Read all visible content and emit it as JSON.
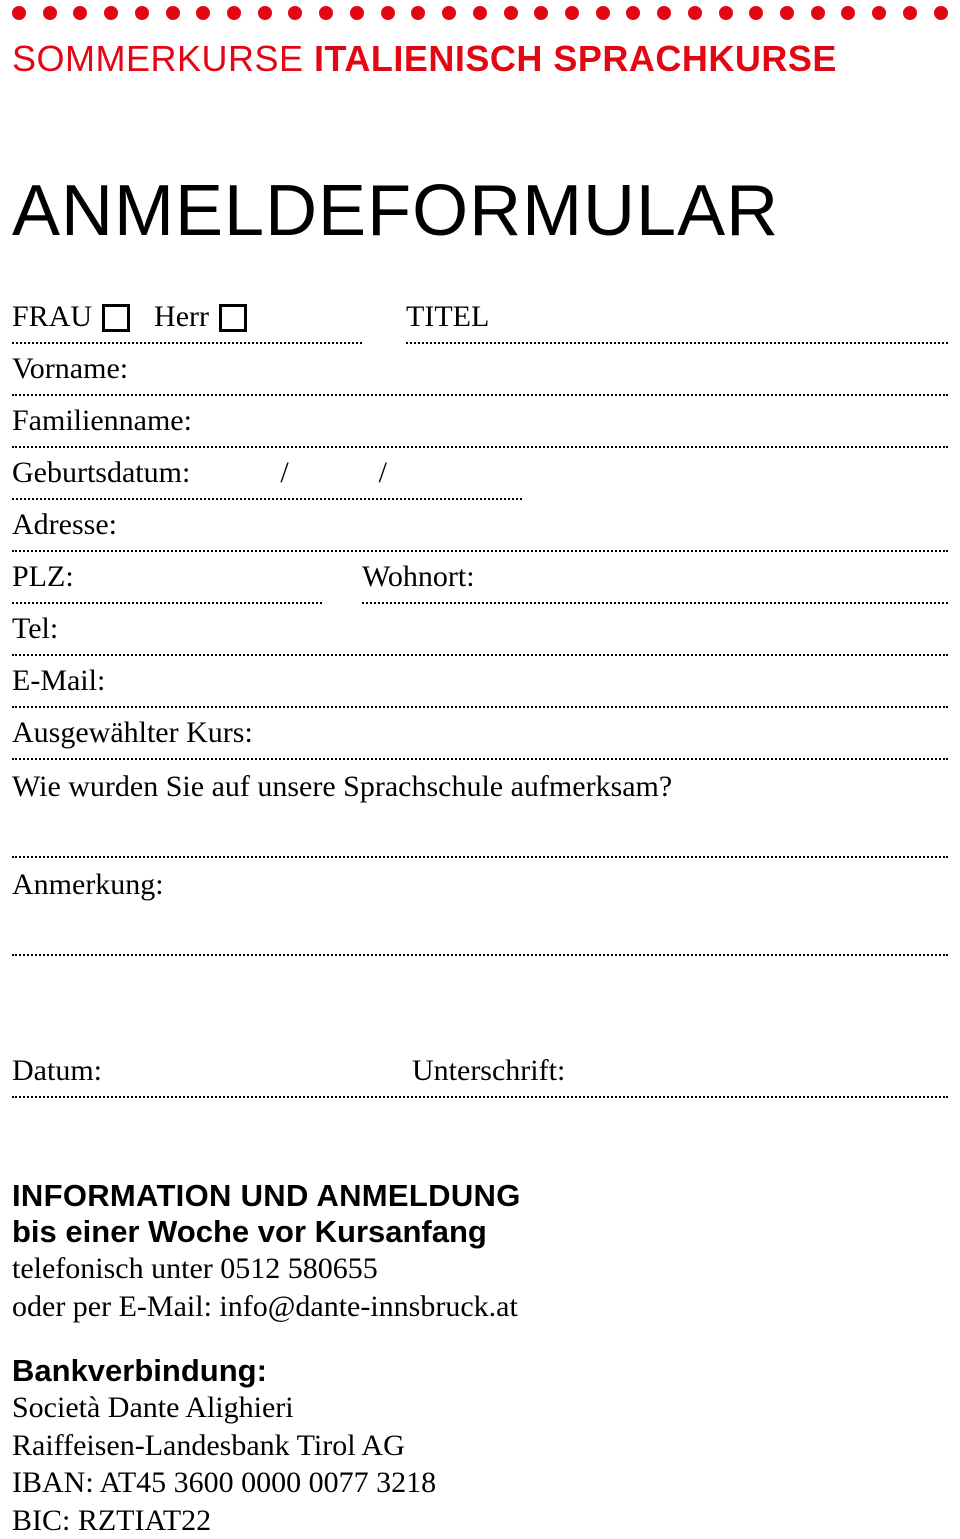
{
  "colors": {
    "accent": "#e30613"
  },
  "dots_count": 31,
  "header": {
    "part_light": "SOMMERKURSE",
    "part_bold": "ITALIENISCH SPRACHKURSE"
  },
  "form": {
    "title": "ANMELDEFORMULAR",
    "salutation": {
      "frau_label": "FRAU",
      "herr_label": "Herr",
      "titel_label": "TITEL"
    },
    "vorname_label": "Vorname:",
    "familienname_label": "Familienname:",
    "geburtsdatum_label": "Geburtsdatum:",
    "adresse_label": "Adresse:",
    "plz_label": "PLZ:",
    "wohnort_label": "Wohnort:",
    "tel_label": "Tel:",
    "email_label": "E-Mail:",
    "kurs_label": "Ausgewählter Kurs:",
    "aufmerksam_label": "Wie wurden Sie auf unsere Sprachschule aufmerksam?",
    "anmerkung_label": "Anmerkung:",
    "datum_label": "Datum:",
    "unterschrift_label": "Unterschrift:"
  },
  "info": {
    "heading": "INFORMATION UND ANMELDUNG",
    "deadline": "bis einer Woche vor Kursanfang",
    "phone_line": "telefonisch unter 0512 580655",
    "email_line": "oder per E-Mail: info@dante-innsbruck.at"
  },
  "bank": {
    "heading": "Bankverbindung:",
    "name": "Società Dante Alighieri",
    "bankname": "Raiffeisen-Landesbank Tirol AG",
    "iban": "IBAN: AT45 3600 0000 0077 3218",
    "bic": "BIC: RZTIAT22"
  }
}
